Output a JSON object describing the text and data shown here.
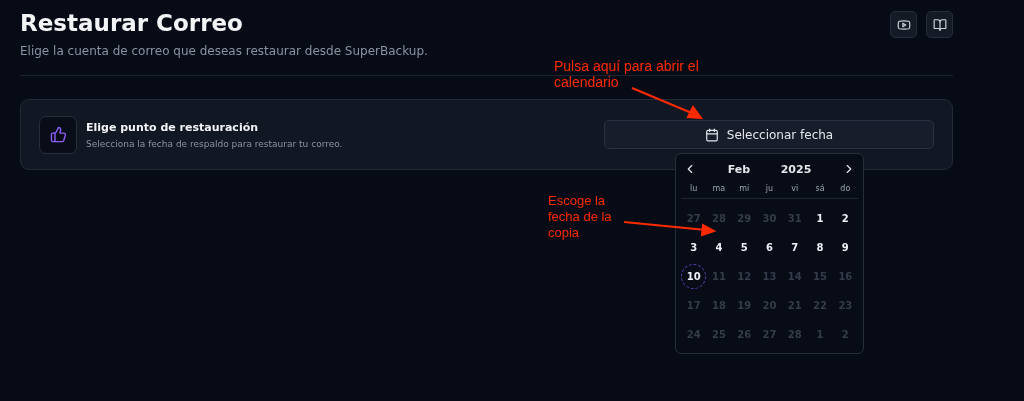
{
  "header": {
    "title": "Restaurar Correo",
    "subtitle": "Elige la cuenta de correo que deseas restaurar desde SuperBackup."
  },
  "card": {
    "title": "Elige punto de restauración",
    "description": "Selecciona la fecha de respaldo para restaurar tu correo.",
    "button": "Seleccionar fecha"
  },
  "calendar": {
    "month": "Feb",
    "year": "2025",
    "weekdays": [
      "lu",
      "ma",
      "mi",
      "ju",
      "vi",
      "sá",
      "do"
    ],
    "days": [
      {
        "label": "27",
        "disabled": true,
        "today": false
      },
      {
        "label": "28",
        "disabled": true,
        "today": false
      },
      {
        "label": "29",
        "disabled": true,
        "today": false
      },
      {
        "label": "30",
        "disabled": true,
        "today": false
      },
      {
        "label": "31",
        "disabled": true,
        "today": false
      },
      {
        "label": "1",
        "disabled": false,
        "today": false
      },
      {
        "label": "2",
        "disabled": false,
        "today": false
      },
      {
        "label": "3",
        "disabled": false,
        "today": false
      },
      {
        "label": "4",
        "disabled": false,
        "today": false
      },
      {
        "label": "5",
        "disabled": false,
        "today": false
      },
      {
        "label": "6",
        "disabled": false,
        "today": false
      },
      {
        "label": "7",
        "disabled": false,
        "today": false
      },
      {
        "label": "8",
        "disabled": false,
        "today": false
      },
      {
        "label": "9",
        "disabled": false,
        "today": false
      },
      {
        "label": "10",
        "disabled": false,
        "today": true
      },
      {
        "label": "11",
        "disabled": true,
        "today": false
      },
      {
        "label": "12",
        "disabled": true,
        "today": false
      },
      {
        "label": "13",
        "disabled": true,
        "today": false
      },
      {
        "label": "14",
        "disabled": true,
        "today": false
      },
      {
        "label": "15",
        "disabled": true,
        "today": false
      },
      {
        "label": "16",
        "disabled": true,
        "today": false
      },
      {
        "label": "17",
        "disabled": true,
        "today": false
      },
      {
        "label": "18",
        "disabled": true,
        "today": false
      },
      {
        "label": "19",
        "disabled": true,
        "today": false
      },
      {
        "label": "20",
        "disabled": true,
        "today": false
      },
      {
        "label": "21",
        "disabled": true,
        "today": false
      },
      {
        "label": "22",
        "disabled": true,
        "today": false
      },
      {
        "label": "23",
        "disabled": true,
        "today": false
      },
      {
        "label": "24",
        "disabled": true,
        "today": false
      },
      {
        "label": "25",
        "disabled": true,
        "today": false
      },
      {
        "label": "26",
        "disabled": true,
        "today": false
      },
      {
        "label": "27",
        "disabled": true,
        "today": false
      },
      {
        "label": "28",
        "disabled": true,
        "today": false
      },
      {
        "label": "1",
        "disabled": true,
        "today": false
      },
      {
        "label": "2",
        "disabled": true,
        "today": false
      }
    ]
  },
  "annotations": [
    {
      "text": "Pulsa aquí para abrir el calendario"
    },
    {
      "text": "Escoge la fecha de la copia"
    }
  ]
}
